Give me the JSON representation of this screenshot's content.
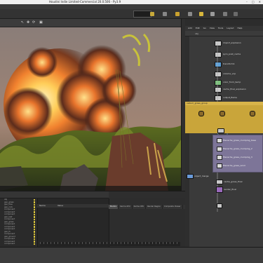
{
  "window": {
    "title": "Houdini Indie Limited-Commercial 20.0.506 - Py3.9"
  },
  "viewport": {
    "status_text": "",
    "tools": [
      "↖",
      "✥",
      "⟳",
      "▣"
    ]
  },
  "network": {
    "menu": [
      "Add",
      "Edit",
      "Go",
      "View",
      "Tools",
      "Layout",
      "Help"
    ],
    "path": "obj",
    "group_box_label": "vellum_grass_group",
    "nodes_top": [
      {
        "label": "import_explosion"
      },
      {
        "label": "pyro_post_cache"
      },
      {
        "label": "transform1"
      },
      {
        "label": "volume_vop"
      },
      {
        "label": "color_from_temp"
      },
      {
        "label": "cache_final_explosion"
      },
      {
        "label": "output_flame"
      }
    ],
    "purple_nodes": [
      {
        "label": "filecache_grass_clumping_base"
      },
      {
        "label": "filecache_grass_clumping_2"
      },
      {
        "label": "filecache_grass_clumping_3"
      },
      {
        "label": "filecache_grass_wind"
      }
    ],
    "bottom_nodes": [
      {
        "label": "object_merge"
      },
      {
        "label": "cache_grass_final"
      },
      {
        "label": "render_final"
      }
    ]
  },
  "bottom_panel": {
    "tabs": [
      "",
      "",
      "",
      "",
      ""
    ],
    "tree_rows": [
      "obj",
      "geo_grass",
      "geo_tree",
      "geo_rock",
      "component",
      "component",
      "component",
      "geo_leaf",
      "component",
      "geo_grass",
      "component",
      "component",
      "component",
      "geo_fx",
      "component",
      "geo_ground",
      "component",
      "component",
      "component"
    ],
    "params_header": [
      "Name",
      "Value"
    ],
    "pp_tabs": [
      "Mantra",
      "Karma XPU",
      "Karma CPU",
      "Render Region",
      "Composite Viewer"
    ]
  },
  "colors": {
    "accent_yellow": "#c9a53a",
    "node_purple": "#7d7598",
    "background": "#2b2b2b"
  }
}
